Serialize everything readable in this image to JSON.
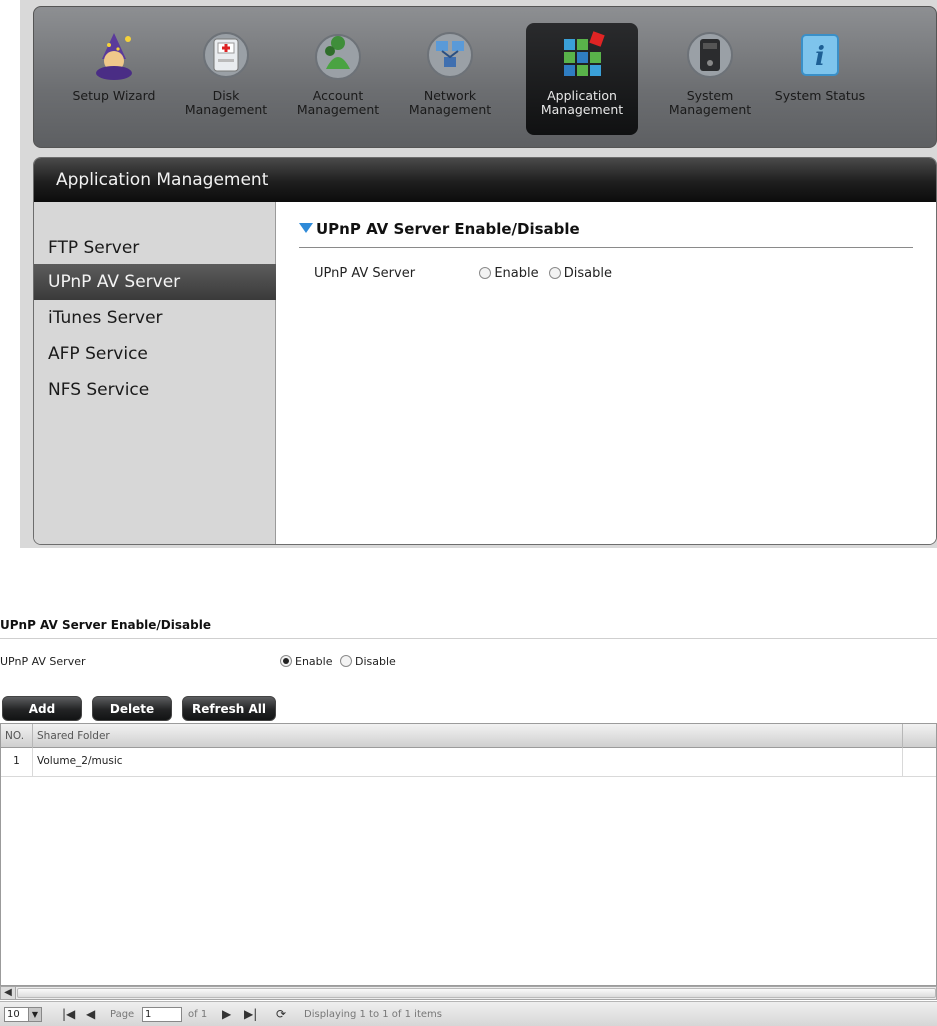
{
  "toolbar": {
    "items": [
      {
        "label": "Setup Wizard",
        "icon": "wizard-icon"
      },
      {
        "label": "Disk\nManagement",
        "icon": "disk-icon"
      },
      {
        "label": "Account\nManagement",
        "icon": "account-icon"
      },
      {
        "label": "Network\nManagement",
        "icon": "network-icon"
      },
      {
        "label": "Application\nManagement",
        "icon": "application-icon"
      },
      {
        "label": "System\nManagement",
        "icon": "system-icon"
      },
      {
        "label": "System Status",
        "icon": "info-icon"
      }
    ],
    "active_index": 4
  },
  "panel": {
    "title": "Application Management",
    "menu": [
      "FTP Server",
      "UPnP AV Server",
      "iTunes Server",
      "AFP Service",
      "NFS Service"
    ],
    "active_menu_index": 1,
    "section_title": "UPnP AV Server Enable/Disable",
    "field_label": "UPnP AV Server",
    "option_enable": "Enable",
    "option_disable": "Disable",
    "selected": "none"
  },
  "detail": {
    "section_title": "UPnP AV Server Enable/Disable",
    "field_label": "UPnP AV Server",
    "option_enable": "Enable",
    "option_disable": "Disable",
    "selected": "Enable",
    "buttons": {
      "add": "Add",
      "delete": "Delete",
      "refresh": "Refresh All"
    },
    "table": {
      "columns": [
        "NO.",
        "Shared Folder"
      ],
      "rows": [
        {
          "no": "1",
          "folder": "Volume_2/music"
        }
      ]
    },
    "pager": {
      "page_size": "10",
      "page_label": "Page",
      "page_value": "1",
      "of_label": "of 1",
      "status": "Displaying 1 to 1 of 1 items"
    }
  },
  "colors": {
    "accent_blue": "#2e8ad8",
    "menu_active": "#4a4a4a",
    "header_dark": "#1e1e1e"
  }
}
